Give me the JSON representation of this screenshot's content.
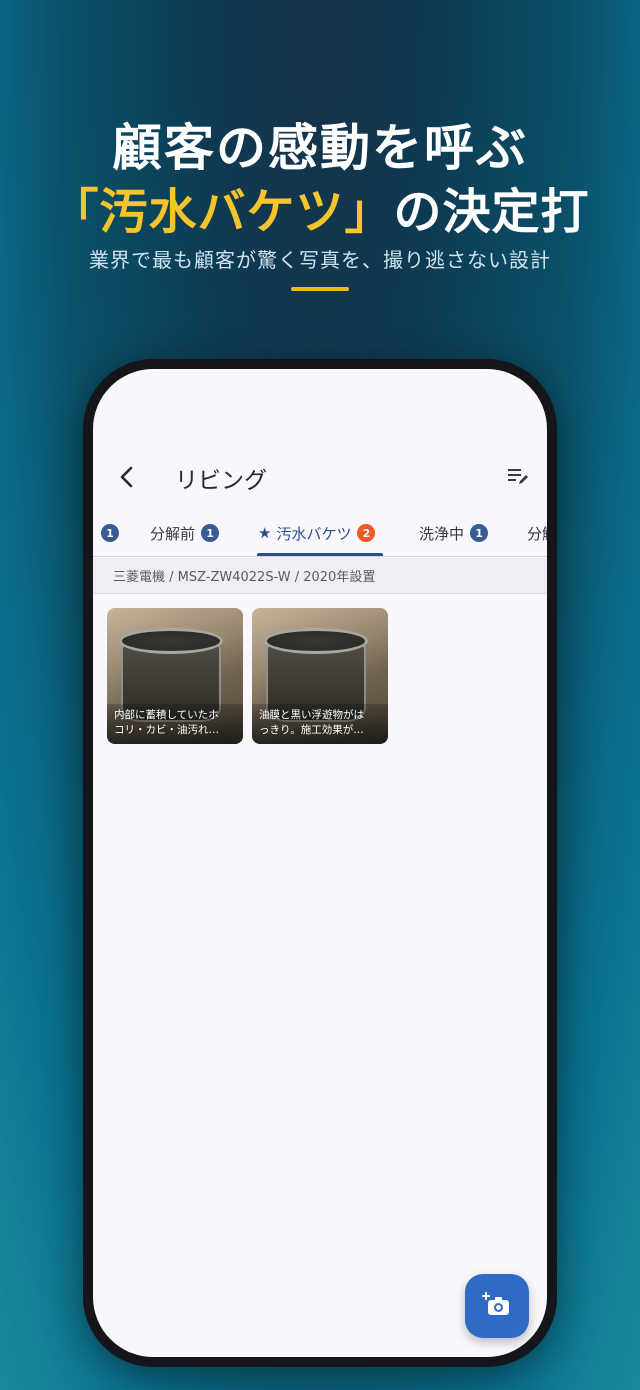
{
  "hero": {
    "line1": "顧客の感動を呼ぶ",
    "line2_accent": "「汚水バケツ」",
    "line2_rest": "の決定打",
    "subtitle": "業界で最も顧客が驚く写真を、撮り逃さない設計"
  },
  "appbar": {
    "title": "リビング"
  },
  "tabs": [
    {
      "label": "",
      "count": "1"
    },
    {
      "label": "分解前",
      "count": "1"
    },
    {
      "label": "汚水バケツ",
      "count": "2",
      "active": true
    },
    {
      "label": "洗浄中",
      "count": "1"
    },
    {
      "label": "分解",
      "count": ""
    }
  ],
  "model_info": "三菱電機 / MSZ-ZW4022S-W / 2020年設置",
  "photos": [
    {
      "caption_line1": "内部に蓄積していたホ",
      "caption_line2": "コリ・カビ・油汚れ…"
    },
    {
      "caption_line1": "油膜と黒い浮遊物がは",
      "caption_line2": "っきり。施工効果が…"
    }
  ],
  "colors": {
    "accent_yellow": "#f7c52b",
    "primary_blue": "#2d4f8c",
    "active_badge": "#f05a28",
    "fab_blue": "#2f6bc6"
  },
  "icons": {
    "back": "back-arrow-icon",
    "edit": "edit-list-icon",
    "star": "star-icon",
    "fab": "add-photo-camera-icon"
  }
}
